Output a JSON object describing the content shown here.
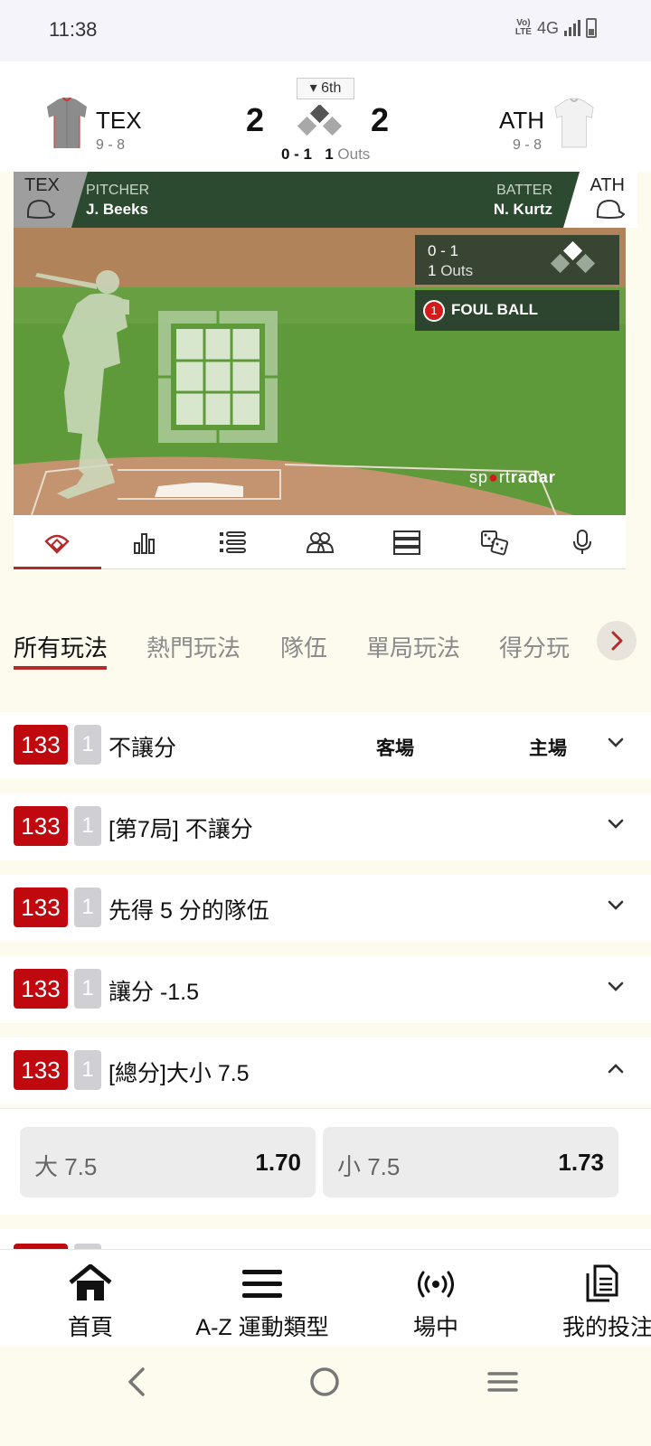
{
  "status_bar": {
    "time": "11:38",
    "volte": "Vo) LTE",
    "network": "4G"
  },
  "game": {
    "inning": "6th",
    "away": {
      "code": "TEX",
      "record": "9 - 8",
      "score": "2"
    },
    "home": {
      "code": "ATH",
      "record": "9 - 8",
      "score": "2"
    },
    "count": "0 - 1",
    "outs_num": "1",
    "outs_label": "Outs"
  },
  "matchup": {
    "pitcher_team": "TEX",
    "pitcher_label": "PITCHER",
    "pitcher_name": "J. Beeks",
    "batter_team": "ATH",
    "batter_label": "BATTER",
    "batter_name": "N. Kurtz"
  },
  "field": {
    "overlay_count": "0 - 1",
    "overlay_outs_num": "1",
    "overlay_outs_label": "Outs",
    "event_number": "1",
    "event_text": "FOUL BALL",
    "brand_a": "sp",
    "brand_b": "rt",
    "brand_c": "radar"
  },
  "icon_tabs": [
    "field-icon",
    "stats-icon",
    "play-by-play-icon",
    "lineup-icon",
    "standings-icon",
    "odds-dice-icon",
    "commentary-mic-icon"
  ],
  "market_tabs": [
    "所有玩法",
    "熱門玩法",
    "隊伍",
    "單局玩法",
    "得分玩"
  ],
  "markets": [
    {
      "badge": "133",
      "sub": "1",
      "title": "不讓分",
      "away_col": "客場",
      "home_col": "主場"
    },
    {
      "badge": "133",
      "sub": "1",
      "title": "[第7局] 不讓分"
    },
    {
      "badge": "133",
      "sub": "1",
      "title": "先得 5 分的隊伍"
    },
    {
      "badge": "133",
      "sub": "1",
      "title": "讓分 -1.5"
    },
    {
      "badge": "133",
      "sub": "1",
      "title": "[總分]大小 7.5"
    }
  ],
  "odds": [
    {
      "label": "大 7.5",
      "value": "1.70"
    },
    {
      "label": "小 7.5",
      "value": "1.73"
    }
  ],
  "bottom_nav": [
    {
      "label": "首頁",
      "icon": "home-icon"
    },
    {
      "label": "A-Z 運動類型",
      "icon": "menu-icon"
    },
    {
      "label": "場中",
      "icon": "live-icon"
    },
    {
      "label": "我的投注",
      "icon": "bets-icon"
    }
  ],
  "colors": {
    "accent": "#b42a2a",
    "badge": "#c0090f",
    "field_green": "#5e9a3a",
    "bar_green": "#2c4a30"
  }
}
